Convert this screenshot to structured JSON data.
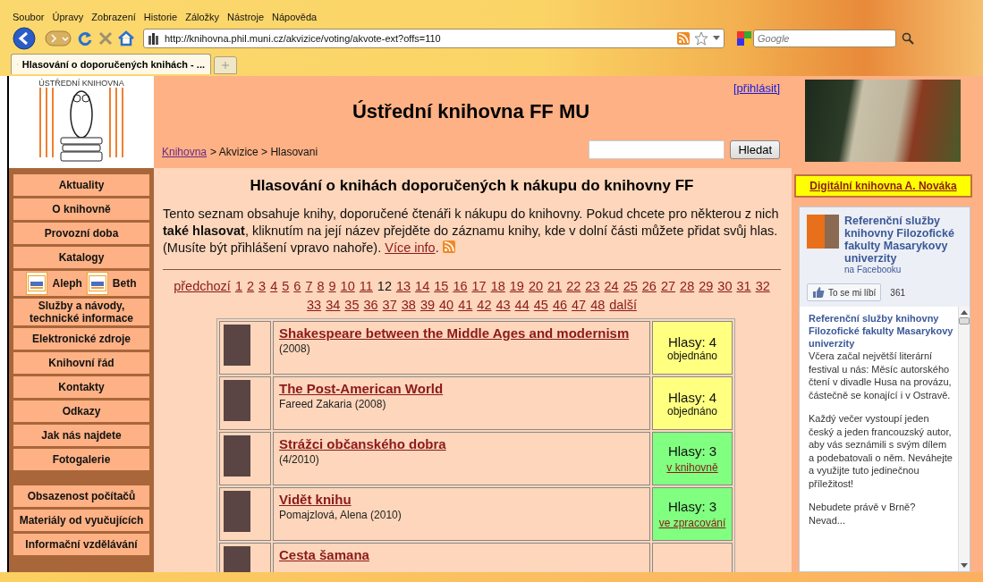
{
  "browser": {
    "menu": [
      "Soubor",
      "Úpravy",
      "Zobrazení",
      "Historie",
      "Záložky",
      "Nástroje",
      "Nápověda"
    ],
    "url": "http://knihovna.phil.muni.cz/akvizice/voting/akvote-ext?offs=110",
    "search_placeholder": "Google",
    "tabs": [
      {
        "label": "Hlasování o doporučených knihách - ...",
        "selected": true
      }
    ]
  },
  "logo": {
    "caption": "ÚSTŘEDNÍ KNIHOVNA"
  },
  "header": {
    "title": "Ústřední knihovna FF MU",
    "login": "[přihlásit]",
    "breadcrumb": [
      {
        "label": "Knihovna",
        "kind": "link"
      },
      {
        "label": "> Akvizice > Hlasovani",
        "kind": "text"
      }
    ],
    "search_button": "Hledat"
  },
  "sidebar": {
    "groups": [
      [
        {
          "kind": "link",
          "label": "Aktuality"
        },
        {
          "kind": "link",
          "label": "O knihovně"
        },
        {
          "kind": "link",
          "label": "Provozní doba"
        },
        {
          "kind": "link",
          "label": "Katalogy"
        },
        {
          "kind": "pair",
          "parts": [
            {
              "label": "Aleph"
            },
            {
              "label": "Beth"
            }
          ]
        },
        {
          "kind": "link",
          "label": "Služby a návody, technické informace"
        },
        {
          "kind": "link",
          "label": "Elektronické zdroje"
        },
        {
          "kind": "link",
          "label": "Knihovní řád"
        },
        {
          "kind": "link",
          "label": "Kontakty"
        },
        {
          "kind": "link",
          "label": "Odkazy"
        },
        {
          "kind": "link",
          "label": "Jak nás najdete"
        },
        {
          "kind": "link",
          "label": "Fotogalerie"
        }
      ],
      [
        {
          "kind": "link",
          "label": "Obsazenost počítačů"
        },
        {
          "kind": "link",
          "label": "Materiály od vyučujících"
        },
        {
          "kind": "link",
          "label": "Informační vzdělávání"
        }
      ]
    ]
  },
  "main": {
    "heading": "Hlasování o knihách doporučených k nákupu do knihovny FF",
    "intro": {
      "text": "Tento seznam obsahuje knihy, doporučené čtenáři k nákupu do knihovny. Pokud chcete pro některou z nich **také hlasovat**, kliknutím na její název přejděte do záznamu knihy, kde v dolní části můžete přidat svůj hlas. (Musíte být přihlášení vpravo nahoře). ",
      "link": "Více info",
      "after": "."
    },
    "pagination": {
      "prev": "předchozí",
      "next": "další",
      "pages": [
        {
          "label": "1",
          "selected": false
        },
        {
          "label": "2",
          "selected": false
        },
        {
          "label": "3",
          "selected": false
        },
        {
          "label": "4",
          "selected": false
        },
        {
          "label": "5",
          "selected": false
        },
        {
          "label": "6",
          "selected": false
        },
        {
          "label": "7",
          "selected": false
        },
        {
          "label": "8",
          "selected": false
        },
        {
          "label": "9",
          "selected": false
        },
        {
          "label": "10",
          "selected": false
        },
        {
          "label": "11",
          "selected": false
        },
        {
          "label": "12",
          "selected": true
        },
        {
          "label": "13",
          "selected": false
        },
        {
          "label": "14",
          "selected": false
        },
        {
          "label": "15",
          "selected": false
        },
        {
          "label": "16",
          "selected": false
        },
        {
          "label": "17",
          "selected": false
        },
        {
          "label": "18",
          "selected": false
        },
        {
          "label": "19",
          "selected": false
        },
        {
          "label": "20",
          "selected": false
        },
        {
          "label": "21",
          "selected": false
        },
        {
          "label": "22",
          "selected": false
        },
        {
          "label": "23",
          "selected": false
        },
        {
          "label": "24",
          "selected": false
        },
        {
          "label": "25",
          "selected": false
        },
        {
          "label": "26",
          "selected": false
        },
        {
          "label": "27",
          "selected": false
        },
        {
          "label": "28",
          "selected": false
        },
        {
          "label": "29",
          "selected": false
        },
        {
          "label": "30",
          "selected": false
        },
        {
          "label": "31",
          "selected": false
        },
        {
          "label": "32",
          "selected": false
        },
        {
          "label": "33",
          "selected": false
        },
        {
          "label": "34",
          "selected": false
        },
        {
          "label": "35",
          "selected": false
        },
        {
          "label": "36",
          "selected": false
        },
        {
          "label": "37",
          "selected": false
        },
        {
          "label": "38",
          "selected": false
        },
        {
          "label": "39",
          "selected": false
        },
        {
          "label": "40",
          "selected": false
        },
        {
          "label": "41",
          "selected": false
        },
        {
          "label": "42",
          "selected": false
        },
        {
          "label": "43",
          "selected": false
        },
        {
          "label": "44",
          "selected": false
        },
        {
          "label": "45",
          "selected": false
        },
        {
          "label": "46",
          "selected": false
        },
        {
          "label": "47",
          "selected": false
        },
        {
          "label": "48",
          "selected": false
        }
      ]
    },
    "books": [
      {
        "title": "Shakespeare between the Middle Ages and modernism",
        "meta": "(2008)",
        "votes": "Hlasy: 4",
        "status": "objednáno",
        "status_linked": false,
        "color": "#ffff80"
      },
      {
        "title": "The Post-American World",
        "meta": "Fareed Zakaria (2008)",
        "votes": "Hlasy: 4",
        "status": "objednáno",
        "status_linked": false,
        "color": "#ffff80"
      },
      {
        "title": "Strážci občanského dobra",
        "meta": "(4/2010)",
        "votes": "Hlasy: 3",
        "status": "v knihovně",
        "status_linked": true,
        "color": "#80ff80"
      },
      {
        "title": "Vidět knihu",
        "meta": "Pomajzlová, Alena (2010)",
        "votes": "Hlasy: 3",
        "status": "ve zpracování",
        "status_linked": true,
        "color": "#80ff80"
      },
      {
        "title": "Cesta šamana"
      }
    ]
  },
  "aside": {
    "digital_library": "Digitální knihovna A. Nováka",
    "facebook": {
      "page_name": "Referenční služby knihovny Filozofické fakulty Masarykovy univerzity",
      "suffix": "na Facebooku",
      "like": "To se mi líbí",
      "count": "361",
      "post": {
        "author": "Referenční služby knihovny Filozofické fakulty Masarykovy univerzity",
        "paragraphs": [
          "Včera začal největší literární festival u nás: Měsíc autorského čtení v divadle Husa na provázu, částečně se konající i v Ostravě.",
          "Každý večer vystoupí jeden český a jeden francouzský autor, aby vás seznámili s svým dílem a podebatovali o něm. Neváhejte a využijte tuto jedinečnou příležitost!",
          "Nebudete právě v Brně? Nevad..."
        ]
      }
    }
  }
}
